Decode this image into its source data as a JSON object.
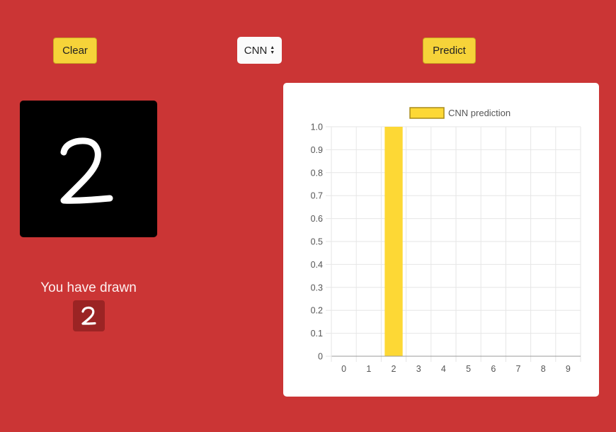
{
  "buttons": {
    "clear_label": "Clear",
    "predict_label": "Predict"
  },
  "model_select": {
    "selected": "CNN"
  },
  "result": {
    "label": "You have drawn",
    "digit": "2"
  },
  "canvas": {
    "drawn_digit": "2"
  },
  "colors": {
    "background": "#cb3535",
    "button": "#f6d339",
    "bar": "#fdd835",
    "badge": "#9b2424"
  },
  "chart_data": {
    "type": "bar",
    "categories": [
      "0",
      "1",
      "2",
      "3",
      "4",
      "5",
      "6",
      "7",
      "8",
      "9"
    ],
    "series": [
      {
        "name": "CNN prediction",
        "values": [
          0,
          0,
          1.0,
          0,
          0,
          0,
          0,
          0,
          0,
          0
        ]
      }
    ],
    "ylim": [
      0,
      1.0
    ],
    "yticks": [
      "0",
      "0.1",
      "0.2",
      "0.3",
      "0.4",
      "0.5",
      "0.6",
      "0.7",
      "0.8",
      "0.9",
      "1.0"
    ],
    "grid": true,
    "legend": "top"
  }
}
